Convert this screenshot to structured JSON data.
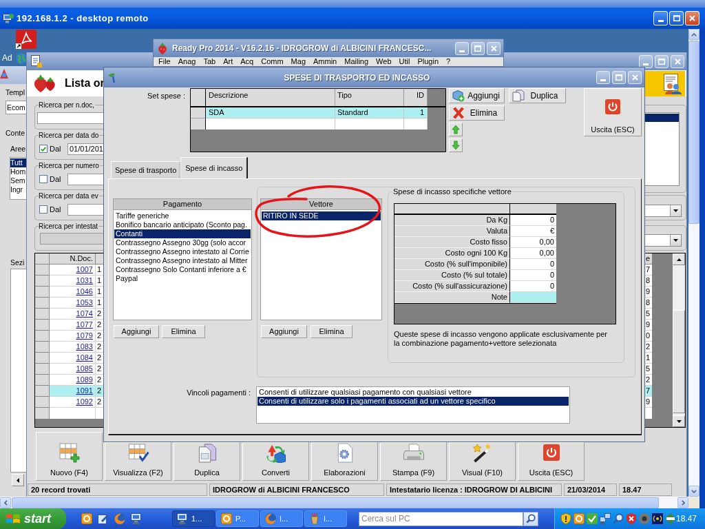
{
  "remote_desktop": {
    "title": "192.168.1.2 - desktop remoto"
  },
  "desktop": {
    "icon_label": "Ad"
  },
  "back_window": {
    "template_label": "Templ",
    "template_value": "Ecom",
    "content_label": "Conte",
    "areas_label": "Aree",
    "areas": [
      {
        "label": "Tutt",
        "selected": true
      },
      {
        "label": "Hom",
        "selected": false
      },
      {
        "label": "Sem",
        "selected": false
      },
      {
        "label": "Ingr",
        "selected": false
      }
    ],
    "section_label": "Sezi"
  },
  "list_window": {
    "title": "Lista or",
    "searches": [
      {
        "kind": "text",
        "label": "Ricerca per n.doc,",
        "disabled": false
      },
      {
        "kind": "date",
        "label": "Ricerca per data do",
        "checkbox_label": "Dal",
        "checked": true,
        "value": "01/01/201"
      },
      {
        "kind": "date",
        "label": "Ricerca per numero",
        "checkbox_label": "Dal",
        "checked": false
      },
      {
        "kind": "date",
        "label": "Ricerca per data ev",
        "checkbox_label": "Dal",
        "checked": false
      },
      {
        "kind": "text",
        "label": "Ricerca per intestat",
        "disabled": true
      }
    ],
    "table": {
      "columns": [
        "N.Doc.",
        "e"
      ],
      "rows": [
        {
          "n_doc": "1007",
          "column_2": "1",
          "last_column": "7",
          "selected": false
        },
        {
          "n_doc": "1031",
          "column_2": "1",
          "last_column": "8",
          "selected": false
        },
        {
          "n_doc": "1046",
          "column_2": "1",
          "last_column": "9",
          "selected": false
        },
        {
          "n_doc": "1053",
          "column_2": "1",
          "last_column": "8",
          "selected": false
        },
        {
          "n_doc": "1074",
          "column_2": "2",
          "last_column": "5",
          "selected": false
        },
        {
          "n_doc": "1077",
          "column_2": "2",
          "last_column": "9",
          "selected": false
        },
        {
          "n_doc": "1079",
          "column_2": "2",
          "last_column": "0",
          "selected": false
        },
        {
          "n_doc": "1083",
          "column_2": "2",
          "last_column": "2",
          "selected": false
        },
        {
          "n_doc": "1084",
          "column_2": "2",
          "last_column": "1",
          "selected": false
        },
        {
          "n_doc": "1085",
          "column_2": "2",
          "last_column": "5",
          "selected": false
        },
        {
          "n_doc": "1089",
          "column_2": "2",
          "last_column": "2",
          "selected": false
        },
        {
          "n_doc": "1091",
          "column_2": "2",
          "last_column": "7",
          "selected": true
        },
        {
          "n_doc": "1092",
          "column_2": "2",
          "last_column": "9",
          "selected": false
        }
      ]
    },
    "toolbar": [
      {
        "label": "Nuovo (F4)",
        "kind": "new"
      },
      {
        "label": "Visualizza (F2)",
        "kind": "view"
      },
      {
        "label": "Duplica",
        "kind": "duplicate"
      },
      {
        "label": "Converti",
        "kind": "convert"
      },
      {
        "label": "Elaborazioni",
        "kind": "process"
      },
      {
        "label": "Stampa (F9)",
        "kind": "print"
      },
      {
        "label": "Visual (F10)",
        "kind": "visual"
      },
      {
        "label": "Uscita (ESC)",
        "kind": "exit"
      }
    ],
    "status_bar": [
      "20 record trovati",
      "IDROGROW di ALBICINI FRANCESCO",
      "Intestatario licenza : IDROGROW DI ALBICINI",
      "21/03/2014",
      "18.47"
    ]
  },
  "main_window": {
    "title": "Ready Pro 2014 - V16.2.16 - IDROGROW di ALBICINI FRANCESC...",
    "menu": [
      "File",
      "Anag",
      "Tab",
      "Art",
      "Acq",
      "Comm",
      "Mag",
      "Ammin",
      "Mailing",
      "Web",
      "Util",
      "Plugin",
      "?"
    ]
  },
  "dialog": {
    "title": "SPESE DI TRASPORTO ED INCASSO",
    "set_spese": {
      "label": "Set spese :",
      "columns": [
        "Descrizione",
        "Tipo",
        "ID"
      ],
      "rows": [
        {
          "cells": [
            "SDA",
            "Standard",
            "1"
          ],
          "selected": true
        }
      ]
    },
    "buttons": [
      {
        "label": "Aggiungi",
        "kind": "add"
      },
      {
        "label": "Duplica",
        "kind": "duplicate"
      },
      {
        "label": "Elimina",
        "kind": "delete"
      }
    ],
    "exit_button": {
      "label": "Uscita (ESC)"
    },
    "tabs": [
      {
        "label": "Spese di trasporto",
        "selected": false
      },
      {
        "label": "Spese di incasso",
        "selected": true
      }
    ],
    "payments": {
      "header": "Pagamento",
      "items": [
        {
          "label": "Tariffe generiche",
          "selected": false
        },
        {
          "label": "Bonifico bancario anticipato (Sconto pag.",
          "selected": false
        },
        {
          "label": "Contanti",
          "selected": true
        },
        {
          "label": "Contrassegno Assegno 30gg (solo accor",
          "selected": false
        },
        {
          "label": "Contrassegno Assegno intestato al Corrie",
          "selected": false
        },
        {
          "label": "Contrassegno Assegno intestato al Mitter",
          "selected": false
        },
        {
          "label": "Contrassegno Solo Contanti inferiore a €",
          "selected": false
        },
        {
          "label": "Paypal",
          "selected": false
        }
      ],
      "buttons": [
        "Aggiungi",
        "Elimina"
      ]
    },
    "carriers": {
      "header": "Vettore",
      "items": [
        {
          "label": "RITIRO IN SEDE",
          "selected": true
        }
      ],
      "buttons": [
        "Aggiungi",
        "Elimina"
      ]
    },
    "carrier_fees": {
      "title": "Spese di incasso specifiche vettore",
      "rows": [
        {
          "label": "Da Kg",
          "value": "0",
          "selected": false
        },
        {
          "label": "Valuta",
          "value": "€",
          "selected": false
        },
        {
          "label": "Costo fisso",
          "value": "0,00",
          "selected": false
        },
        {
          "label": "Costo ogni 100 Kg",
          "value": "0,00",
          "selected": false
        },
        {
          "label": "Costo (% sull'imponibile)",
          "value": "0",
          "selected": false
        },
        {
          "label": "Costo (% sul totale)",
          "value": "0",
          "selected": false
        },
        {
          "label": "Costo (% sull'assicurazione)",
          "value": "0",
          "selected": false
        },
        {
          "label": "Note",
          "selected": true
        }
      ],
      "note": "Queste spese di incasso vengono applicate esclusivamente per la combinazione pagamento+vettore selezionata"
    },
    "constraints": {
      "label": "Vincoli pagamenti :",
      "options": [
        {
          "label": "Consenti di utilizzare qualsiasi pagamento con qualsiasi vettore",
          "selected": false
        },
        {
          "label": "Consenti di utilizzare solo i pagamenti associati ad un vettore specifico",
          "selected": true
        }
      ]
    }
  },
  "taskbar": {
    "start": "start",
    "tasks": [
      {
        "label": "1...",
        "kind": "remote",
        "active": true
      },
      {
        "label": "P...",
        "kind": "mail",
        "active": false
      },
      {
        "label": "I...",
        "kind": "browser",
        "active": false
      },
      {
        "label": "I...",
        "kind": "paint",
        "active": false
      }
    ],
    "search": {
      "placeholder": "Cerca sul PC"
    },
    "clock": "18.47"
  }
}
